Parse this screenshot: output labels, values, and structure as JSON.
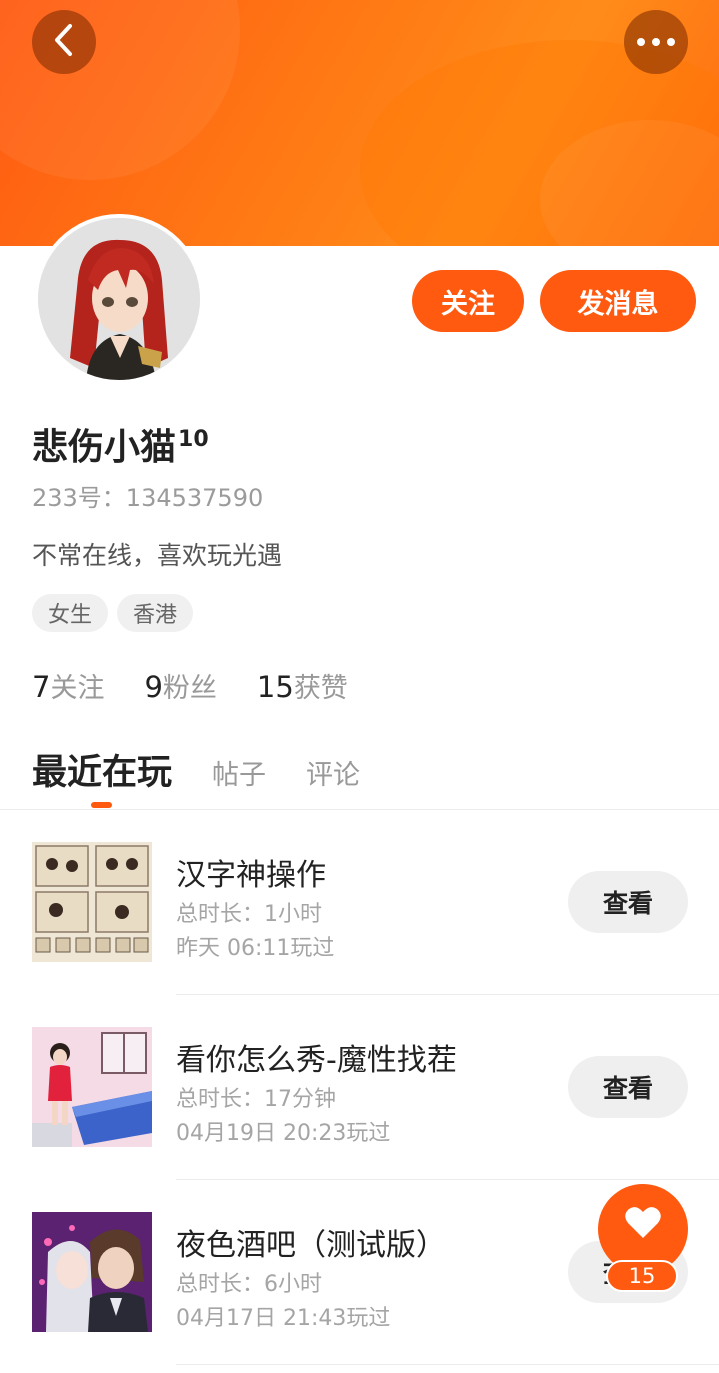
{
  "header": {
    "back_icon": "chevron-left-icon",
    "more_icon": "more-dots-icon",
    "accent": "#ff5a0f"
  },
  "profile": {
    "name": "悲伤小猫",
    "level": "10",
    "id_text": "233号：134537590",
    "bio": "不常在线，喜欢玩光遇",
    "tags": [
      "女生",
      "香港"
    ],
    "follow_label": "关注",
    "message_label": "发消息",
    "stats": [
      {
        "num": "7",
        "label": "关注"
      },
      {
        "num": "9",
        "label": "粉丝"
      },
      {
        "num": "15",
        "label": "获赞"
      }
    ]
  },
  "tabs": [
    {
      "label": "最近在玩",
      "active": true
    },
    {
      "label": "帖子",
      "active": false
    },
    {
      "label": "评论",
      "active": false
    }
  ],
  "games": [
    {
      "title": "汉字神操作",
      "duration": "总时长：1小时",
      "last_played": "昨天 06:11玩过",
      "button": "查看"
    },
    {
      "title": "看你怎么秀-魔性找茬",
      "duration": "总时长：17分钟",
      "last_played": "04月19日 20:23玩过",
      "button": "查看"
    },
    {
      "title": "夜色酒吧（测试版）",
      "duration": "总时长：6小时",
      "last_played": "04月17日 21:43玩过",
      "button": "查看"
    }
  ],
  "like_fab": {
    "icon": "heart-icon",
    "count": "15"
  }
}
